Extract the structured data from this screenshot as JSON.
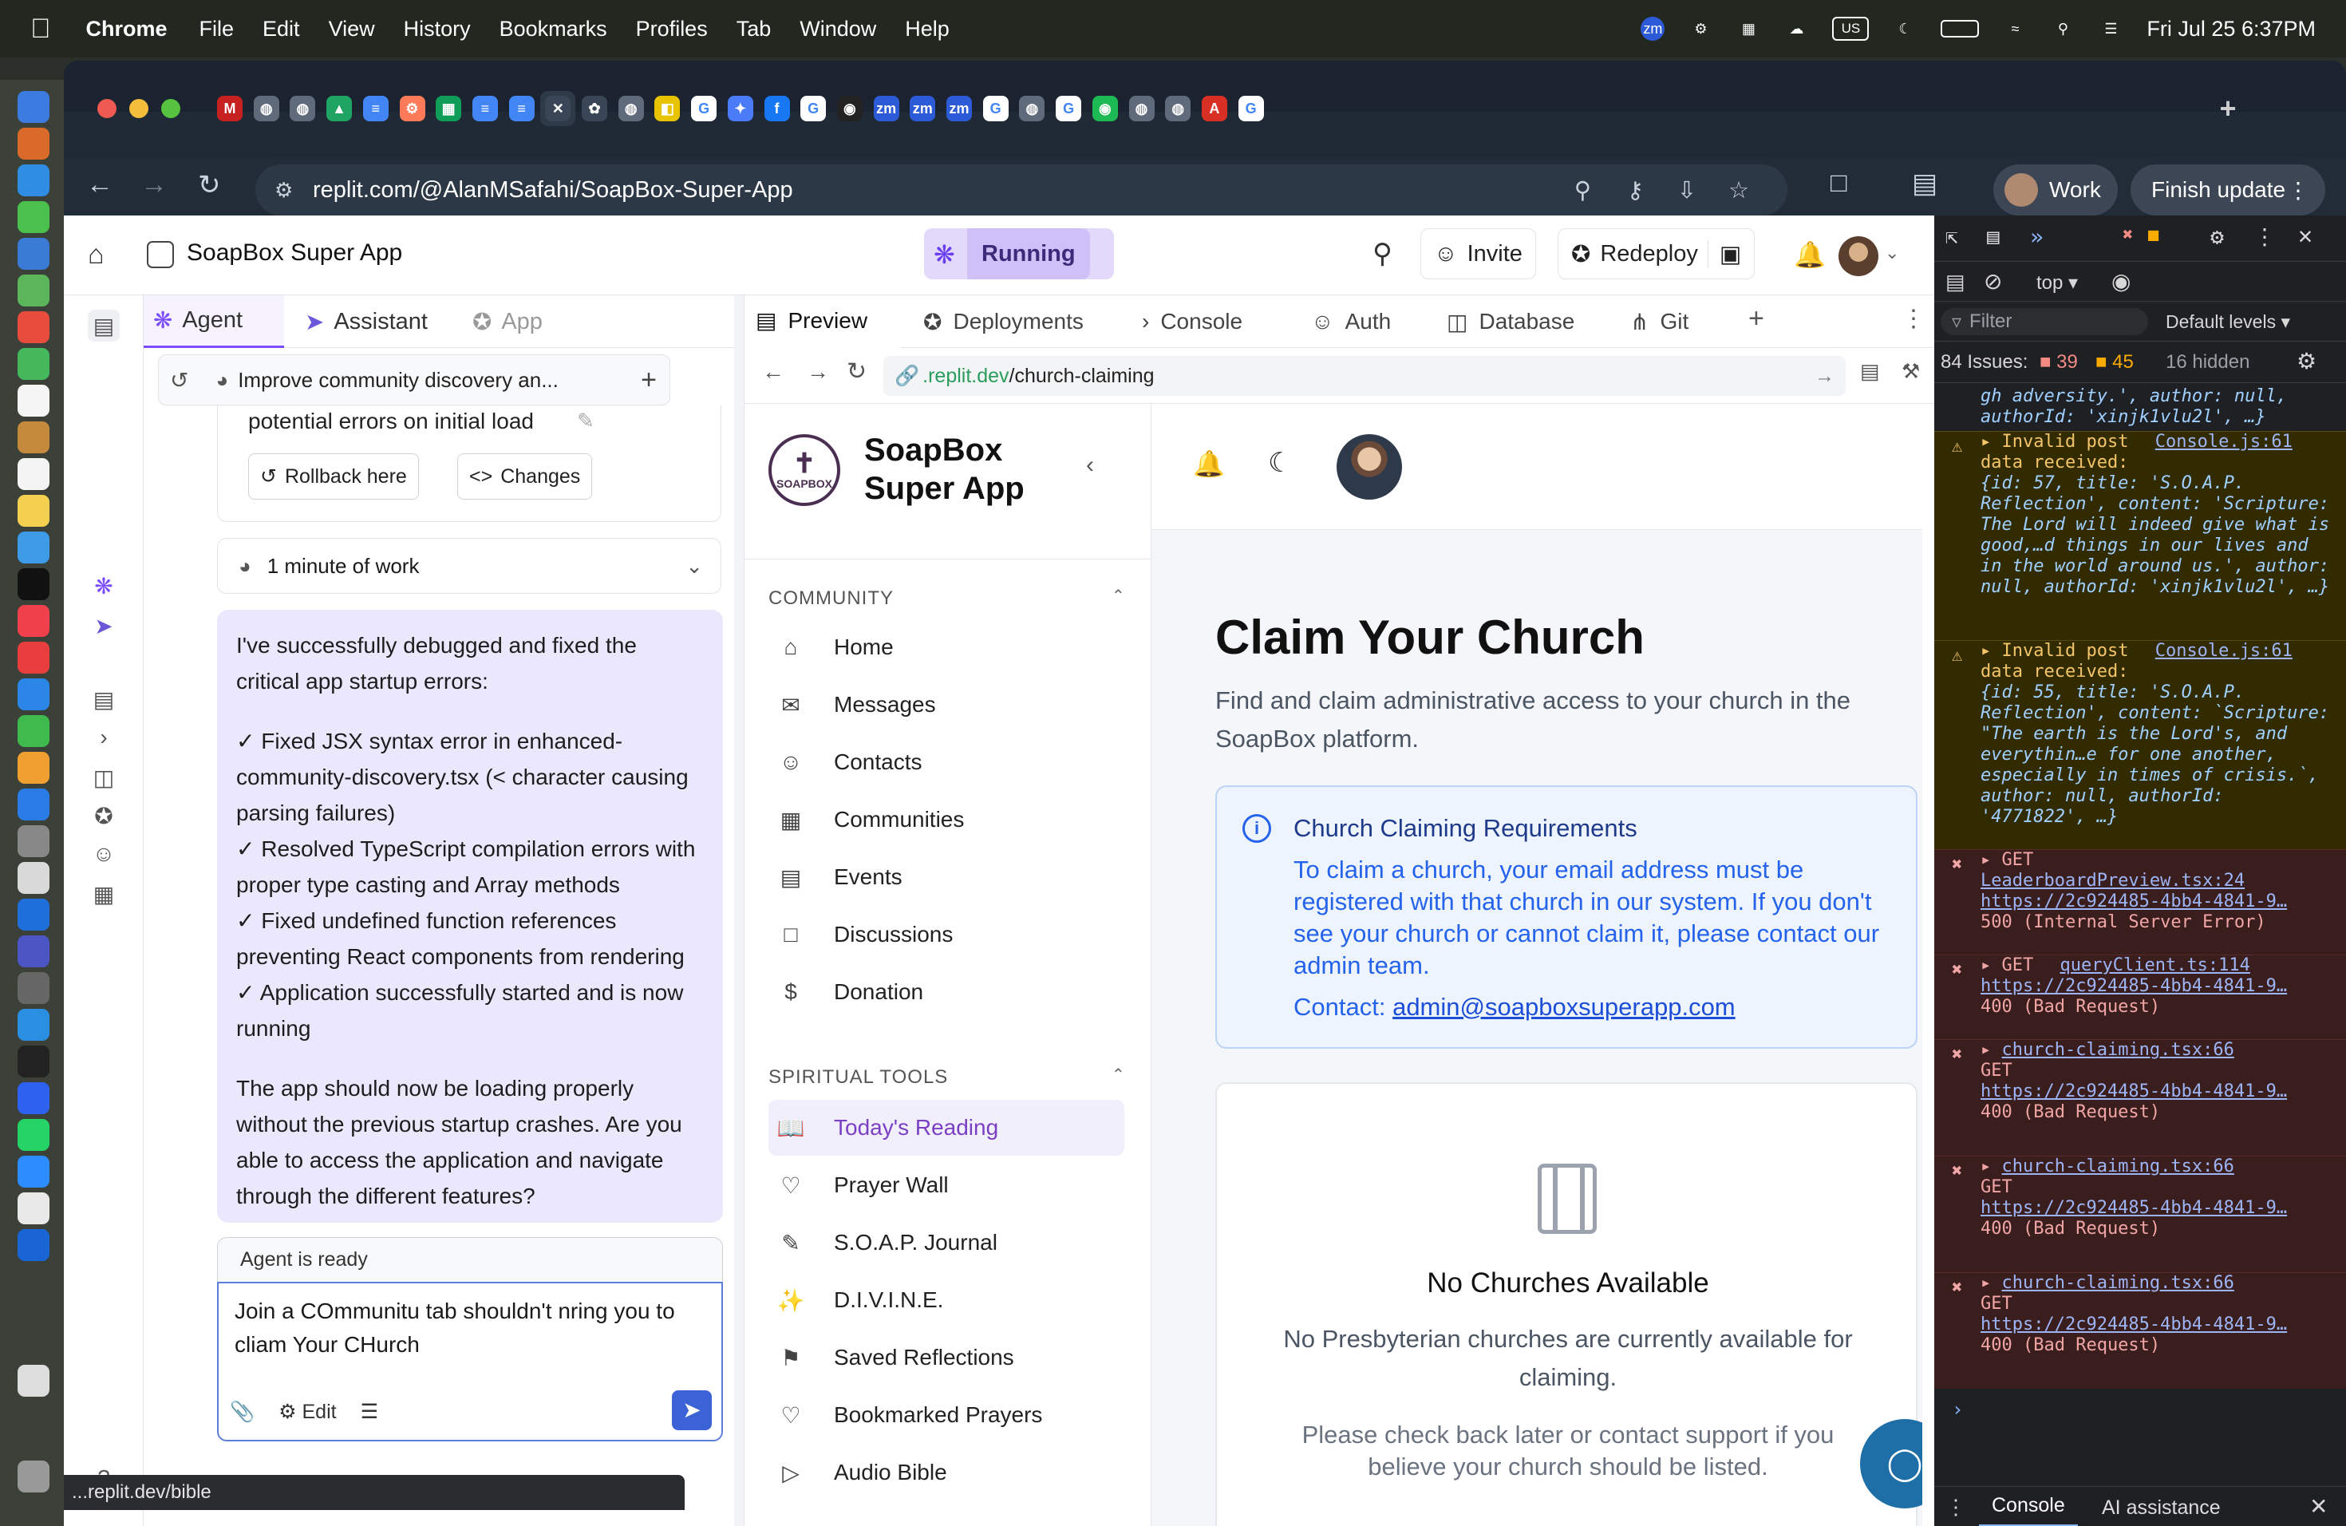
{
  "menubar": {
    "app": "Chrome",
    "items": [
      "File",
      "Edit",
      "View",
      "History",
      "Bookmarks",
      "Profiles",
      "Tab",
      "Window",
      "Help"
    ],
    "status_icons": [
      "zm",
      "wifi-icon",
      "battery-icon",
      "moon-icon",
      "search-icon",
      "control-center-icon"
    ],
    "keyboard": "US",
    "datetime": "Fri Jul 25  6:37PM"
  },
  "browser": {
    "url": "replit.com/@AlanMSafahi/SoapBox-Super-App",
    "work_profile": "Work",
    "finish_update": "Finish update",
    "tab_icons": [
      "gmail",
      "globe",
      "globe",
      "drive",
      "docs",
      "hubspot",
      "sheets",
      "docs",
      "docs",
      "close",
      "openai",
      "globe",
      "wallet",
      "google",
      "gemini",
      "facebook",
      "google",
      "github",
      "zm",
      "zm",
      "zm",
      "google",
      "globe",
      "google",
      "spotify",
      "globe",
      "globe",
      "red",
      "google"
    ]
  },
  "replit": {
    "project_name": "SoapBox Super App",
    "running_label": "Running",
    "invite_label": "Invite",
    "redeploy_label": "Redeploy",
    "agent_tabs": [
      "Agent",
      "Assistant",
      "App"
    ],
    "thread_title": "Improve community discovery an...",
    "prev_text": "potential errors on initial load",
    "rollback_label": "Rollback here",
    "changes_label": "Changes",
    "work_label": "1 minute of work",
    "message": {
      "intro": "I've successfully debugged and fixed the critical app startup errors:",
      "checks": [
        "✓ Fixed JSX syntax error in enhanced-community-discovery.tsx (< character causing parsing failures)",
        "✓ Resolved TypeScript compilation errors with proper type casting and Array methods",
        "✓ Fixed undefined function references preventing React components from rendering",
        "✓ Application successfully started and is now running"
      ],
      "outro": "The app should now be loading properly without the previous startup crashes. Are you able to access the application and navigate through the different features?"
    },
    "agent_status": "Agent is ready",
    "input_text": "Join a COmmunitu tab shouldn't nring you to cliam Your CHurch",
    "edit_label": "Edit",
    "preview_tabs": [
      "Preview",
      "Deployments",
      "Console",
      "Auth",
      "Database",
      "Git"
    ],
    "preview_url_prefix": ".replit.dev",
    "preview_url_path": "/church-claiming"
  },
  "app": {
    "title": "SoapBox Super App",
    "logo_text": "SOAPBOX",
    "community_header": "COMMUNITY",
    "community_items": [
      "Home",
      "Messages",
      "Contacts",
      "Communities",
      "Events",
      "Discussions",
      "Donation"
    ],
    "tools_header": "SPIRITUAL TOOLS",
    "tools_items": [
      "Today's Reading",
      "Prayer Wall",
      "S.O.A.P. Journal",
      "D.I.V.I.N.E.",
      "Saved Reflections",
      "Bookmarked Prayers",
      "Audio Bible"
    ],
    "active_item": "Today's Reading",
    "page_title": "Claim Your Church",
    "page_subtitle": "Find and claim administrative access to your church in the SoapBox platform.",
    "req_title": "Church Claiming Requirements",
    "req_body": "To claim a church, your email address must be registered with that church in our system. If you don't see your church or cannot claim it, please contact our admin team.",
    "contact_label": "Contact:",
    "contact_email": "admin@soapboxsuperapp.com",
    "empty_title": "No Churches Available",
    "empty_body": "No Presbyterian churches are currently available for claiming.",
    "empty_note": "Please check back later or contact support if you believe your church should be listed."
  },
  "devtools": {
    "context": "top",
    "filter_placeholder": "Filter",
    "levels": "Default levels",
    "issues_label": "84 Issues:",
    "issues_err": "39",
    "issues_warn": "45",
    "hidden": "16 hidden",
    "logs": [
      {
        "type": "cont",
        "text": "gh adversity.', author: null, authorId: 'xinjk1vlu2l', …}"
      },
      {
        "type": "warn",
        "head": "Invalid post",
        "src": "Console.js:61",
        "head2": "data received:",
        "obj": "{id: 57, title: 'S.O.A.P. Reflection', content: 'Scripture: The Lord will indeed give what is good,…d things in our lives and in the world around us.', author: null, authorId: 'xinjk1vlu2l', …}"
      },
      {
        "type": "warn",
        "head": "Invalid post",
        "src": "Console.js:61",
        "head2": "data received:",
        "obj": "{id: 55, title: 'S.O.A.P. Reflection', content: `Scripture: \"The earth is the Lord's, and everythin…e for one another, especially in times of crisis.`, author: null, authorId: '4771822', …}"
      },
      {
        "type": "err",
        "head": "GET",
        "src": "LeaderboardPreview.tsx:24",
        "url": "https://2c924485-4bb4-4841-9…",
        "status": "500 (Internal Server Error)"
      },
      {
        "type": "err",
        "head": "GET",
        "src": "queryClient.ts:114",
        "url": "https://2c924485-4bb4-4841-9…",
        "status": "400 (Bad Request)"
      },
      {
        "type": "err",
        "head": "GET",
        "src": "church-claiming.tsx:66",
        "url": "https://2c924485-4bb4-4841-9…",
        "status": "400 (Bad Request)"
      },
      {
        "type": "err",
        "head": "GET",
        "src": "church-claiming.tsx:66",
        "url": "https://2c924485-4bb4-4841-9…",
        "status": "400 (Bad Request)"
      },
      {
        "type": "err",
        "head": "GET",
        "src": "church-claiming.tsx:66",
        "url": "https://2c924485-4bb4-4841-9…",
        "status": "400 (Bad Request)"
      }
    ],
    "bottom_tabs": [
      "Console",
      "AI assistance"
    ]
  },
  "statusbar": {
    "text": "...replit.dev/bible"
  },
  "colors": {
    "accent": "#7c4dff",
    "link": "#2563eb",
    "error": "#f1a5a5",
    "warning": "#f4c46a"
  }
}
